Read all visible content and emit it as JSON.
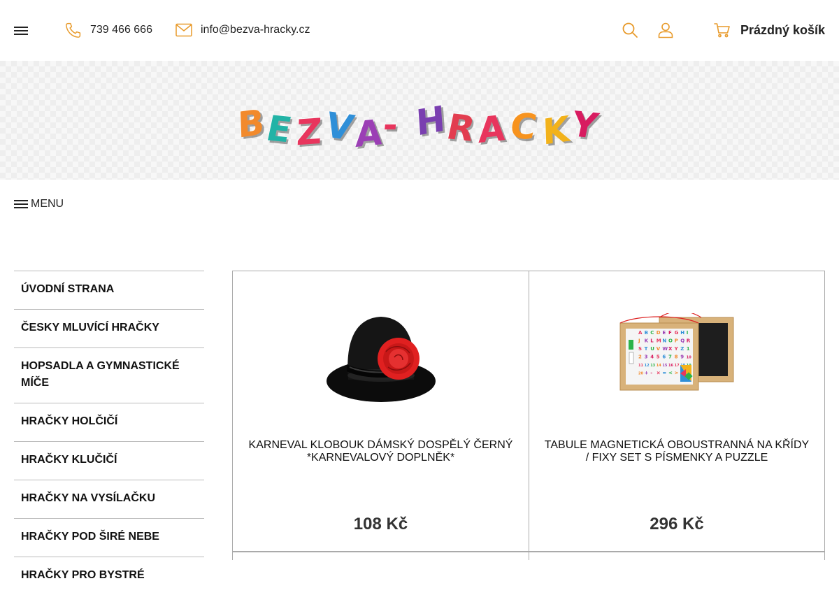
{
  "header": {
    "phone": "739 466 666",
    "email": "info@bezva-hracky.cz",
    "cart_label": "Prázdný košík"
  },
  "logo": {
    "text": "BEZVA-HRACKY",
    "letter_colors": [
      "#f28a2c",
      "#22b3a6",
      "#e8355d",
      "#2f8fd8",
      "#9b3fb5",
      "#e8355d",
      "#7a3fb0",
      "#e23d4f",
      "#e8355d",
      "#f7931e",
      "#f2b21b",
      "#d81b60"
    ]
  },
  "menu": {
    "label": "MENU"
  },
  "sidebar": {
    "items": [
      "ÚVODNÍ STRANA",
      "ČESKY MLUVÍCÍ HRAČKY",
      "HOPSADLA A GYMNASTICKÉ MÍČE",
      "HRAČKY HOLČIČÍ",
      "HRAČKY KLUČIČÍ",
      "HRAČKY NA VYSÍLAČKU",
      "HRAČKY POD ŠIRÉ NEBE",
      "HRAČKY PRO BYSTRÉ"
    ]
  },
  "products": [
    {
      "title": "KARNEVAL KLOBOUK DÁMSKÝ DOSPĚLÝ ČERNÝ *KARNEVALOVÝ DOPLNĚK*",
      "price": "108 Kč",
      "image": "black-hat-with-red-rose"
    },
    {
      "title": "TABULE MAGNETICKÁ OBOUSTRANNÁ NA KŘÍDY / FIXY SET S PÍSMENKY A PUZZLE",
      "price": "296 Kč",
      "image": "magnetic-board-with-letters"
    }
  ],
  "board_letters": [
    "A",
    "B",
    "C",
    "D",
    "E",
    "F",
    "G",
    "H",
    "I",
    "J",
    "K",
    "L",
    "M",
    "N",
    "O",
    "P",
    "Q",
    "R",
    "S",
    "T",
    "U",
    "V",
    "W",
    "X",
    "Y",
    "Z",
    "1",
    "2",
    "3",
    "4",
    "5",
    "6",
    "7",
    "8",
    "9",
    "10",
    "11",
    "12",
    "13",
    "14",
    "15",
    "16",
    "17",
    "18",
    "19",
    "20",
    "+",
    "-",
    "×",
    "=",
    "<",
    ">"
  ]
}
